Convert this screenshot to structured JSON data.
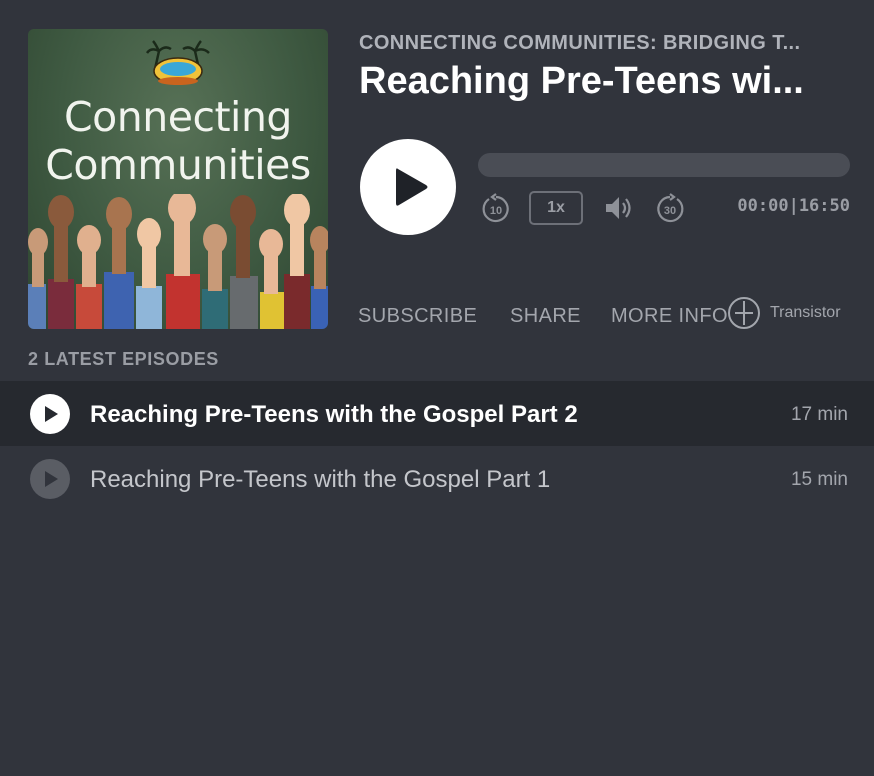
{
  "header": {
    "show_title": "CONNECTING COMMUNITIES: BRIDGING T...",
    "episode_title": "Reaching Pre-Teens wi..."
  },
  "artwork": {
    "title_line1": "Connecting",
    "title_line2": "Communities"
  },
  "player": {
    "play_icon": "play-icon",
    "progress_fraction": 0.0,
    "speed_label": "1x",
    "rewind_seconds": "10",
    "forward_seconds": "30",
    "current_time": "00:00",
    "separator": "|",
    "total_time": "16:50"
  },
  "links": {
    "subscribe": "SUBSCRIBE",
    "share": "SHARE",
    "more_info": "MORE INFO",
    "brand": "Transistor"
  },
  "episodes": {
    "heading": "2 LATEST EPISODES",
    "items": [
      {
        "title": "Reaching Pre-Teens with the Gospel Part 2",
        "duration": "17 min",
        "active": true
      },
      {
        "title": "Reaching Pre-Teens with the Gospel Part 1",
        "duration": "15 min",
        "active": false
      }
    ]
  },
  "colors": {
    "background": "#31343c",
    "active_row": "#26292f",
    "muted_text": "#a3a6ad",
    "progress_track": "#4a4d55"
  }
}
